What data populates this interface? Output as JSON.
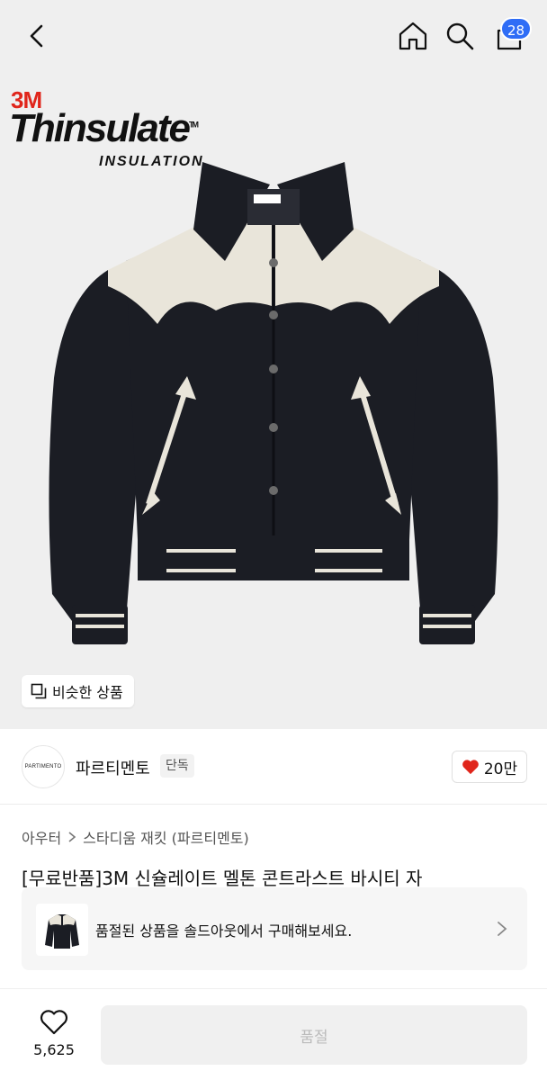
{
  "header": {
    "back_icon": "chevron-left-icon",
    "home_icon": "home-icon",
    "search_icon": "search-icon",
    "bag_icon": "shopping-bag-icon",
    "bag_badge": "28",
    "badge_color": "#2f6df6"
  },
  "hero": {
    "logo_3m": "3M",
    "logo_brand": "Thinsulate",
    "logo_tm": "TM",
    "logo_sub": "INSULATION",
    "similar_label": "비슷한 상품",
    "background": "#efefef"
  },
  "seller": {
    "logo_text": "PARTIMENTO",
    "name": "파르티멘토",
    "tag": "단독",
    "likes": "20만",
    "heart_color": "#e0251b"
  },
  "product": {
    "breadcrumb": [
      "아우터",
      "스타디움 재킷 (파르티멘토)"
    ],
    "title": "[무료반품]3M 신슐레이트 멜톤 콘트라스트 바시티 자"
  },
  "soldout_banner": {
    "text": "품절된 상품을 솔드아웃에서 구매해보세요."
  },
  "bottom": {
    "wish_count": "5,625",
    "buy_label": "품절"
  }
}
